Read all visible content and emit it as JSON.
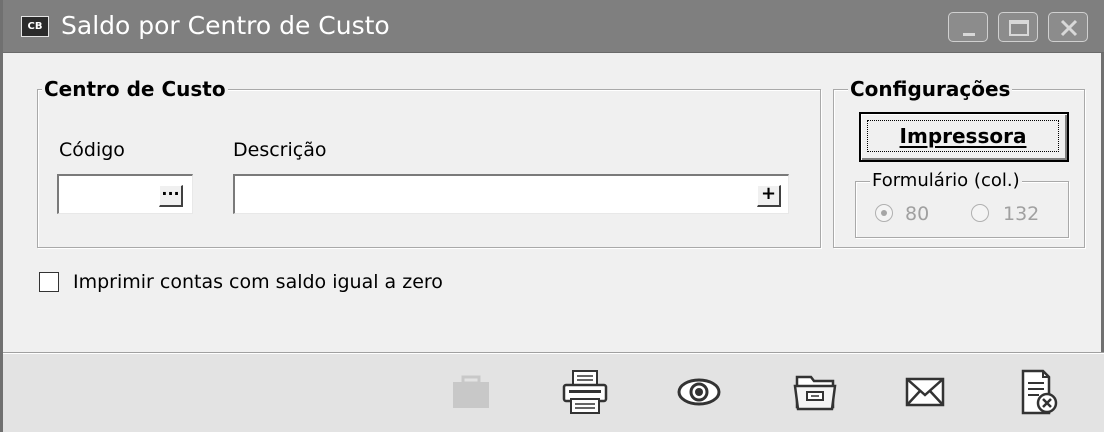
{
  "window": {
    "icon_text": "CB",
    "title": "Saldo por Centro de Custo"
  },
  "centro_custo": {
    "legend": "Centro de Custo",
    "codigo_label": "Código",
    "codigo_value": "",
    "codigo_lookup_label": "···",
    "descricao_label": "Descrição",
    "descricao_value": "",
    "descricao_add_label": "+"
  },
  "configuracoes": {
    "legend": "Configurações",
    "impressora_label": "Impressora",
    "formulario_legend": "Formulário (col.)",
    "options": [
      "80",
      "132"
    ],
    "selected": "80"
  },
  "options": {
    "zero_balance_label": "Imprimir contas com saldo igual a zero",
    "zero_balance_checked": false
  },
  "toolbar": {
    "icons": [
      "briefcase-icon",
      "printer-icon",
      "eye-icon",
      "folder-icon",
      "envelope-icon",
      "close-document-icon"
    ]
  }
}
